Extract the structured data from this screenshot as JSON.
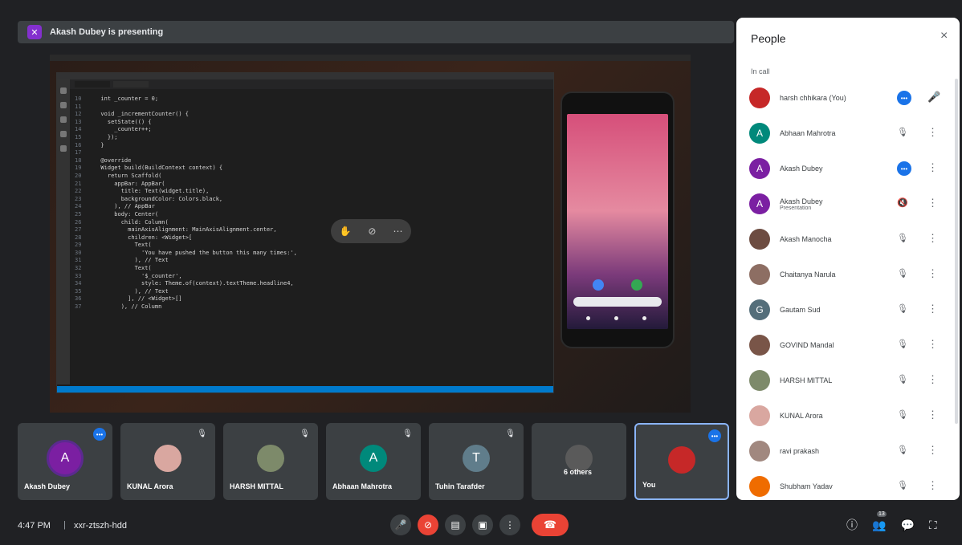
{
  "presenting_bar": {
    "icon": "present-icon",
    "text": "Akash Dubey is presenting"
  },
  "floater": {
    "icons": [
      "hand-icon",
      "mic-off-icon",
      "more-icon"
    ]
  },
  "code": [
    {
      "n": "10",
      "t": "  int _counter = 0;"
    },
    {
      "n": "11",
      "t": ""
    },
    {
      "n": "12",
      "t": "  void _incrementCounter() {"
    },
    {
      "n": "13",
      "t": "    setState(() {"
    },
    {
      "n": "14",
      "t": "      _counter++;"
    },
    {
      "n": "15",
      "t": "    });"
    },
    {
      "n": "16",
      "t": "  }"
    },
    {
      "n": "17",
      "t": ""
    },
    {
      "n": "18",
      "t": "  @override"
    },
    {
      "n": "19",
      "t": "  Widget build(BuildContext context) {"
    },
    {
      "n": "20",
      "t": "    return Scaffold("
    },
    {
      "n": "21",
      "t": "      appBar: AppBar("
    },
    {
      "n": "22",
      "t": "        title: Text(widget.title),"
    },
    {
      "n": "23",
      "t": "        backgroundColor: Colors.black,"
    },
    {
      "n": "24",
      "t": "      ), // AppBar"
    },
    {
      "n": "25",
      "t": "      body: Center("
    },
    {
      "n": "26",
      "t": "        child: Column("
    },
    {
      "n": "27",
      "t": "          mainAxisAlignment: MainAxisAlignment.center,"
    },
    {
      "n": "28",
      "t": "          children: <Widget>["
    },
    {
      "n": "29",
      "t": "            Text("
    },
    {
      "n": "30",
      "t": "              'You have pushed the button this many times:',"
    },
    {
      "n": "31",
      "t": "            ), // Text"
    },
    {
      "n": "32",
      "t": "            Text("
    },
    {
      "n": "33",
      "t": "              '$_counter',"
    },
    {
      "n": "34",
      "t": "              style: Theme.of(context).textTheme.headline4,"
    },
    {
      "n": "35",
      "t": "            ), // Text"
    },
    {
      "n": "36",
      "t": "          ], // <Widget>[]"
    },
    {
      "n": "37",
      "t": "        ), // Column"
    }
  ],
  "tiles": [
    {
      "name": "Akash Dubey",
      "type": "letter",
      "letter": "A",
      "color": "#7b1fa2",
      "status": "speaking"
    },
    {
      "name": "KUNAL Arora",
      "type": "photo",
      "color": "#d9a7a0",
      "status": "muted"
    },
    {
      "name": "HARSH MITTAL",
      "type": "photo",
      "color": "#7d8a6a",
      "status": "muted"
    },
    {
      "name": "Abhaan Mahrotra",
      "type": "letter",
      "letter": "A",
      "color": "#00897b",
      "status": "muted"
    },
    {
      "name": "Tuhin Tarafder",
      "type": "letter",
      "letter": "T",
      "color": "#607d8b",
      "status": "muted"
    },
    {
      "name": "6 others",
      "type": "group",
      "color": "#5a5a5a",
      "status": "none"
    },
    {
      "name": "You",
      "type": "photo",
      "color": "#c62828",
      "status": "speaking"
    }
  ],
  "bottom_bar": {
    "time": "4:47 PM",
    "separator": "|",
    "meeting_code": "xxr-ztszh-hdd",
    "controls": [
      "mic-icon",
      "camera-off-icon",
      "captions-icon",
      "present-screen-icon",
      "more-options-icon"
    ],
    "hangup": "hangup-icon",
    "right": [
      {
        "icon": "info-icon",
        "badge": ""
      },
      {
        "icon": "people-icon",
        "badge": "13"
      },
      {
        "icon": "chat-icon",
        "badge": ""
      },
      {
        "icon": "activities-icon",
        "badge": ""
      }
    ]
  },
  "people_panel": {
    "title": "People",
    "close": "×",
    "section": "In call",
    "people": [
      {
        "name": "harsh chhikara (You)",
        "sub": "",
        "avatar": "photo",
        "letter": "",
        "color": "#c62828",
        "mic": "talking"
      },
      {
        "name": "Abhaan Mahrotra",
        "sub": "",
        "avatar": "letter",
        "letter": "A",
        "color": "#00897b",
        "mic": "muted"
      },
      {
        "name": "Akash Dubey",
        "sub": "",
        "avatar": "letter",
        "letter": "A",
        "color": "#7b1fa2",
        "mic": "talking"
      },
      {
        "name": "Akash Dubey",
        "sub": "Presentation",
        "avatar": "letter",
        "letter": "A",
        "color": "#7b1fa2",
        "mic": "off"
      },
      {
        "name": "Akash Manocha",
        "sub": "",
        "avatar": "photo",
        "letter": "",
        "color": "#6d4c41",
        "mic": "muted"
      },
      {
        "name": "Chaitanya Narula",
        "sub": "",
        "avatar": "photo",
        "letter": "",
        "color": "#8d6e63",
        "mic": "muted"
      },
      {
        "name": "Gautam Sud",
        "sub": "",
        "avatar": "letter",
        "letter": "G",
        "color": "#546e7a",
        "mic": "muted"
      },
      {
        "name": "GOVIND Mandal",
        "sub": "",
        "avatar": "photo",
        "letter": "",
        "color": "#795548",
        "mic": "muted"
      },
      {
        "name": "HARSH MITTAL",
        "sub": "",
        "avatar": "photo",
        "letter": "",
        "color": "#7d8a6a",
        "mic": "muted"
      },
      {
        "name": "KUNAL Arora",
        "sub": "",
        "avatar": "photo",
        "letter": "",
        "color": "#d9a7a0",
        "mic": "muted"
      },
      {
        "name": "ravi prakash",
        "sub": "",
        "avatar": "photo",
        "letter": "",
        "color": "#a1887f",
        "mic": "muted"
      },
      {
        "name": "Shubham Yadav",
        "sub": "",
        "avatar": "photo",
        "letter": "",
        "color": "#ef6c00",
        "mic": "muted"
      }
    ]
  }
}
